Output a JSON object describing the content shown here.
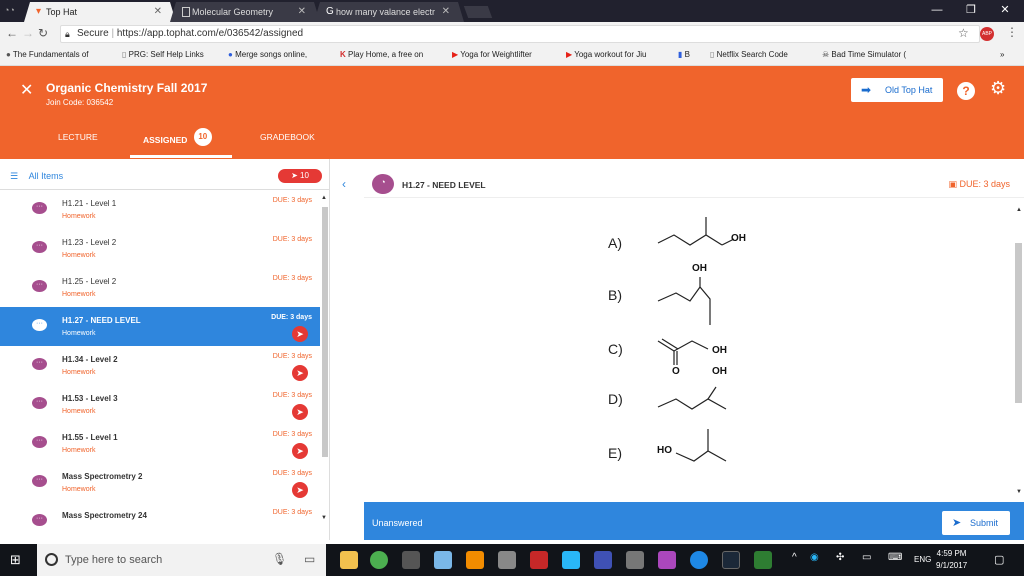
{
  "browser": {
    "tabs": [
      {
        "title": "Top Hat",
        "active": true
      },
      {
        "title": "Molecular Geometry",
        "active": false
      },
      {
        "title": "how many valance electr",
        "active": false
      }
    ],
    "url_secure": "Secure",
    "url": "https://app.tophat.com/e/036542/assigned",
    "bookmarks": [
      "The Fundamentals of",
      "PRG: Self Help Links",
      "Merge songs online,",
      "Play Home, a free on",
      "Yoga for Weightlifter",
      "Yoga workout for Jiu",
      "B",
      "Netflix Search Code",
      "Bad Time Simulator ("
    ]
  },
  "header": {
    "course_title": "Organic Chemistry Fall 2017",
    "join_code": "Join Code: 036542",
    "old_top_hat": "Old Top Hat",
    "tabs": [
      {
        "label": "LECTURE",
        "active": false
      },
      {
        "label": "ASSIGNED",
        "active": true,
        "count": "10"
      },
      {
        "label": "GRADEBOOK",
        "active": false
      }
    ]
  },
  "sidebar": {
    "all_items": "All Items",
    "badge": "10",
    "items": [
      {
        "title": "H1.21 - Level 1",
        "sub": "Homework",
        "due": "DUE: 3 days"
      },
      {
        "title": "H1.23 - Level 2",
        "sub": "Homework",
        "due": "DUE: 3 days"
      },
      {
        "title": "H1.25 - Level 2",
        "sub": "Homework",
        "due": "DUE: 3 days"
      },
      {
        "title": "H1.27 - NEED LEVEL",
        "sub": "Homework",
        "due": "DUE: 3 days"
      },
      {
        "title": "H1.34 - Level 2",
        "sub": "Homework",
        "due": "DUE: 3 days"
      },
      {
        "title": "H1.53 - Level 3",
        "sub": "Homework",
        "due": "DUE: 3 days"
      },
      {
        "title": "H1.55 - Level 1",
        "sub": "Homework",
        "due": "DUE: 3 days"
      },
      {
        "title": "Mass Spectrometry 2",
        "sub": "Homework",
        "due": "DUE: 3 days"
      },
      {
        "title": "Mass Spectrometry 24",
        "sub": "",
        "due": "DUE: 3 days"
      }
    ]
  },
  "question": {
    "title": "H1.27 - NEED LEVEL",
    "due": "DUE: 3 days",
    "options": [
      "A)",
      "B)",
      "C)",
      "D)",
      "E)"
    ],
    "labels": {
      "a_oh": "OH",
      "b_oh": "OH",
      "c_oh": "OH",
      "c_o": "O",
      "d_oh": "OH",
      "e_ho": "HO"
    }
  },
  "footer": {
    "status": "Unanswered",
    "submit": "Submit"
  },
  "taskbar": {
    "search_placeholder": "Type here to search",
    "lang": "ENG",
    "time": "4:59 PM",
    "date": "9/1/2017"
  },
  "colors": {
    "brand_orange": "#f0642c",
    "accent_blue": "#2f86dd",
    "alert_red": "#e53935"
  }
}
